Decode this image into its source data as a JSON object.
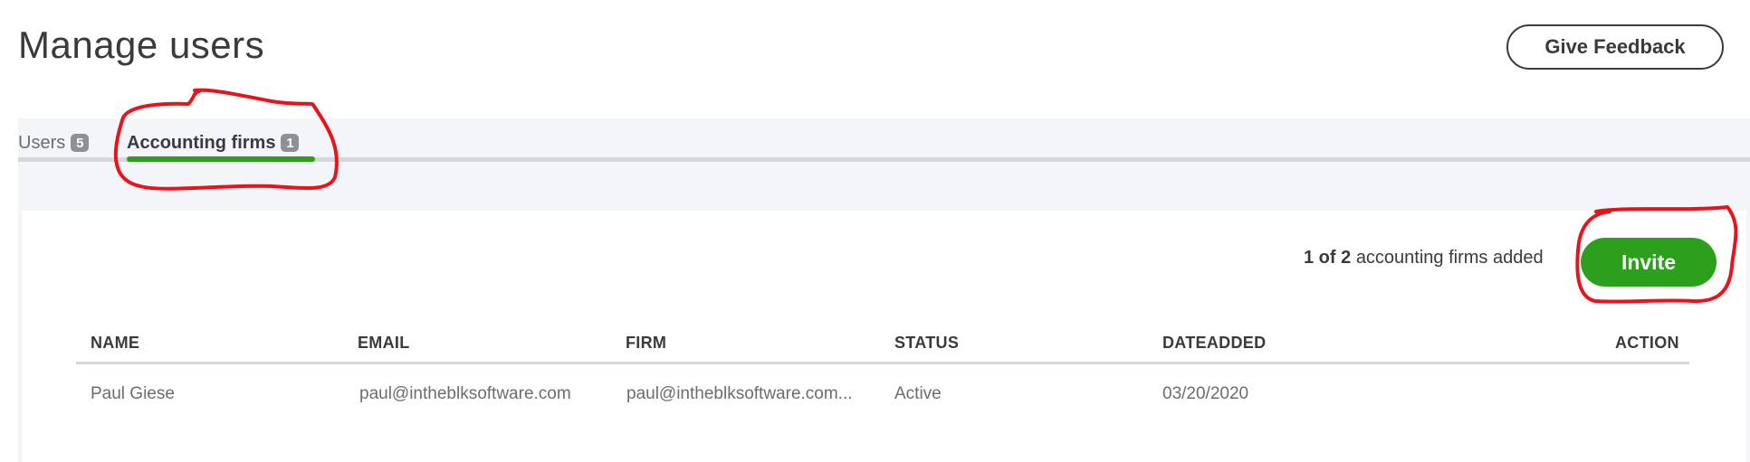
{
  "header": {
    "title": "Manage users",
    "feedback_label": "Give Feedback"
  },
  "tabs": [
    {
      "label": "Users",
      "count": "5",
      "active": false
    },
    {
      "label": "Accounting firms",
      "count": "1",
      "active": true
    }
  ],
  "summary": {
    "added": "1 of 2",
    "suffix": "accounting firms added"
  },
  "invite_label": "Invite",
  "table": {
    "columns": [
      "NAME",
      "EMAIL",
      "FIRM",
      "STATUS",
      "DATEADDED",
      "ACTION"
    ],
    "rows": [
      {
        "name": "Paul Giese",
        "email": "paul@intheblksoftware.com",
        "firm": "paul@intheblksoftware.com...",
        "status": "Active",
        "date_added": "03/20/2020",
        "action": ""
      }
    ]
  },
  "colors": {
    "accent_green": "#2ca01c",
    "annotation_red": "#e8141c",
    "text_dark": "#393a3d",
    "text_gray": "#6b6c72"
  }
}
